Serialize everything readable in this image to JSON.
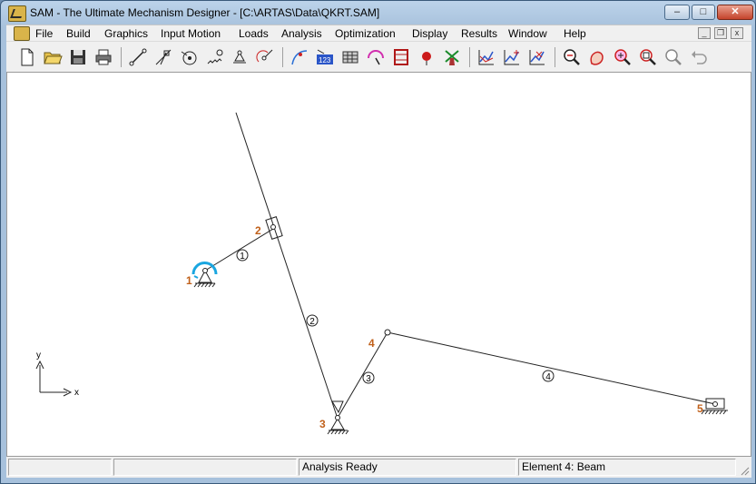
{
  "window": {
    "title": "SAM - The Ultimate Mechanism Designer - [C:\\ARTAS\\Data\\QKRT.SAM]",
    "caption_buttons": {
      "minimize": "–",
      "maximize": "□",
      "close": "✕"
    }
  },
  "menu": {
    "items": [
      "File",
      "Build",
      "Graphics",
      "Input Motion",
      "Loads",
      "Analysis",
      "Optimization",
      "Display",
      "Results",
      "Window",
      "Help"
    ],
    "mdi_buttons": {
      "minimize": "_",
      "restore": "❐",
      "close": "x"
    }
  },
  "toolbar": {
    "buttons": [
      {
        "name": "new-icon"
      },
      {
        "name": "open-folder-icon"
      },
      {
        "name": "save-icon"
      },
      {
        "name": "print-icon"
      },
      {
        "name": "beam-icon"
      },
      {
        "name": "slider-element-icon"
      },
      {
        "name": "gear-element-icon"
      },
      {
        "name": "spring-icon"
      },
      {
        "name": "fixed-support-icon"
      },
      {
        "name": "force-icon"
      },
      {
        "name": "path-icon"
      },
      {
        "name": "numbering-icon"
      },
      {
        "name": "table-icon"
      },
      {
        "name": "motion-icon"
      },
      {
        "name": "frame-icon"
      },
      {
        "name": "balloon-icon"
      },
      {
        "name": "windmill-icon"
      },
      {
        "name": "graph-icon"
      },
      {
        "name": "graph-add-icon"
      },
      {
        "name": "graph-remove-icon"
      },
      {
        "name": "zoom-out-icon"
      },
      {
        "name": "pan-icon"
      },
      {
        "name": "zoom-fit-icon"
      },
      {
        "name": "zoom-window-icon"
      },
      {
        "name": "zoom-previous-icon"
      },
      {
        "name": "undo-icon"
      }
    ]
  },
  "mechanism": {
    "node_labels": [
      "1",
      "2",
      "3",
      "4",
      "5"
    ],
    "element_labels": [
      "1",
      "2",
      "3",
      "4"
    ],
    "axes": {
      "x": "x",
      "y": "y"
    }
  },
  "status": {
    "panes": [
      "",
      "",
      "Analysis Ready",
      "Element 4: Beam"
    ]
  },
  "colors": {
    "node_label": "#c0601a",
    "input_motion": "#1aa6e0"
  }
}
